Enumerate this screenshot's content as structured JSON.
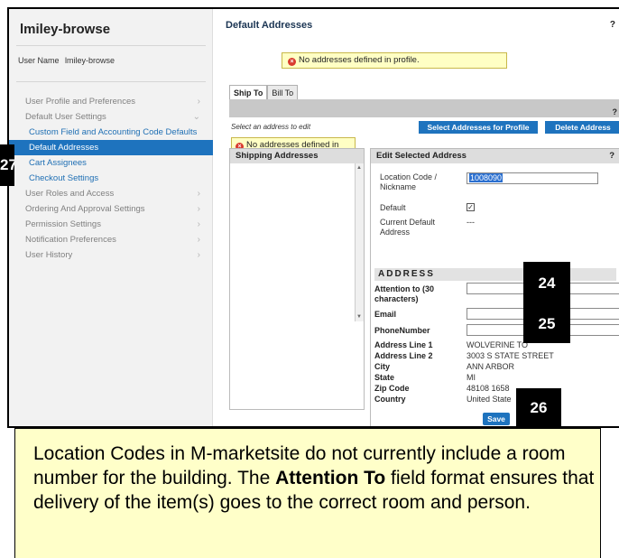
{
  "sidebar": {
    "title": "lmiley-browse",
    "user_label": "User Name",
    "user_value": "lmiley-browse",
    "items": [
      {
        "label": "User Profile and Preferences",
        "chev": "›"
      },
      {
        "label": "Default User Settings",
        "chev": "⌄"
      },
      {
        "label": "Custom Field and Accounting Code Defaults"
      },
      {
        "label": "Default Addresses"
      },
      {
        "label": "Cart Assignees"
      },
      {
        "label": "Checkout Settings"
      },
      {
        "label": "User Roles and Access",
        "chev": "›"
      },
      {
        "label": "Ordering And Approval Settings",
        "chev": "›"
      },
      {
        "label": "Permission Settings",
        "chev": "›"
      },
      {
        "label": "Notification Preferences",
        "chev": "›"
      },
      {
        "label": "User History",
        "chev": "›"
      }
    ]
  },
  "main": {
    "title": "Default Addresses",
    "help": "?",
    "top_message": "No addresses defined in profile.",
    "tabs": [
      "Ship To",
      "Bill To"
    ],
    "bar_help": "?",
    "hint": "Select an address to edit",
    "select_button": "Select Addresses for Profile",
    "delete_button": "Delete Address",
    "side_message": "No addresses defined in profile.",
    "shipping_header": "Shipping Addresses",
    "edit_header": "Edit Selected Address",
    "edit_help": "?",
    "fields": {
      "location_code_label": "Location Code / Nickname",
      "location_code_value": "1008090",
      "default_label": "Default",
      "default_check": "✓",
      "current_default_label": "Current Default Address",
      "current_default_value": "---",
      "address_heading": "ADDRESS",
      "attention_label": "Attention to (30 characters)",
      "email_label": "Email",
      "phone_label": "PhoneNumber",
      "line1_label": "Address Line 1",
      "line1_value": "WOLVERINE TO",
      "line2_label": "Address Line 2",
      "line2_value": "3003 S STATE STREET",
      "city_label": "City",
      "city_value": "ANN ARBOR",
      "state_label": "State",
      "state_value": "MI",
      "zip_label": "Zip Code",
      "zip_value": "48108 1658",
      "country_label": "Country",
      "country_value": "United State"
    },
    "save_button": "Save"
  },
  "steps": {
    "s27": "27",
    "s24": "24",
    "s25": "25",
    "s26": "26"
  },
  "callout": {
    "line1": "Location Codes in M-marketsite do not currently include a room number for the building. The",
    "bold": "Attention To",
    "line2": "field format ensures that delivery of the item(s) goes to the correct room and person."
  },
  "colors": {
    "accent": "#1e73be",
    "message_bg": "#ffffc4",
    "error": "#d93b2f",
    "callout_bg": "#ffffc9"
  }
}
